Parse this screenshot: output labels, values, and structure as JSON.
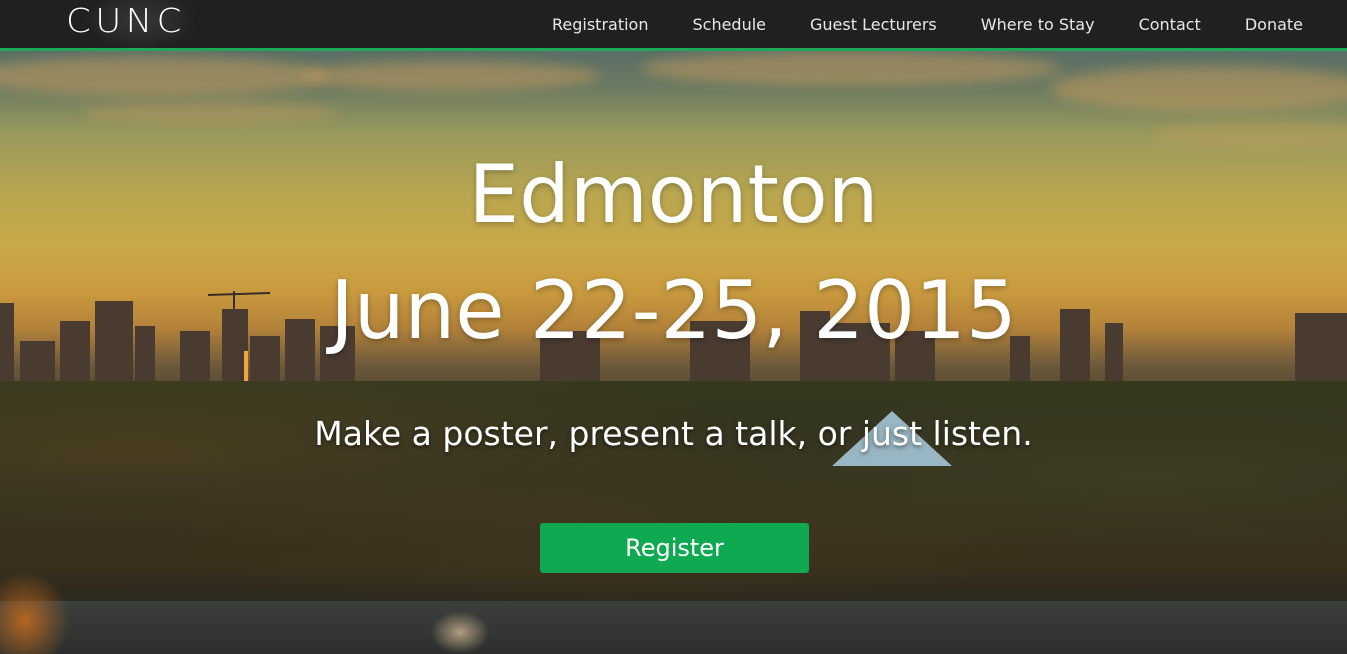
{
  "brand": {
    "logo_text": "CUNC",
    "logo_icon": "tree-emblem-icon"
  },
  "nav": {
    "items": [
      {
        "label": "Registration"
      },
      {
        "label": "Schedule"
      },
      {
        "label": "Guest Lecturers"
      },
      {
        "label": "Where to Stay"
      },
      {
        "label": "Contact"
      },
      {
        "label": "Donate"
      }
    ]
  },
  "hero": {
    "city": "Edmonton",
    "dates": "June 22-25, 2015",
    "tagline": "Make a poster, present a talk, or just listen.",
    "register_label": "Register"
  },
  "colors": {
    "navbar_bg": "#221f20",
    "accent": "#1fa85a",
    "button": "#0fa952"
  }
}
